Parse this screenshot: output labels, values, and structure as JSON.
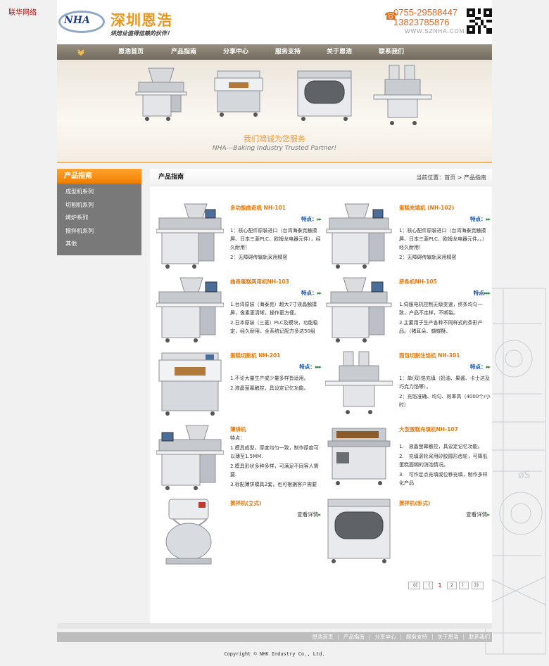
{
  "corner_link": "联华网络",
  "header": {
    "logo_mark": "NHA",
    "logo_name": "深圳恩浩",
    "slogan": "烘焙业值得信赖的伙伴！",
    "tel1": "0755-29588447",
    "tel2": "13823785876",
    "site": "WWW.SZNHA.COM"
  },
  "nav": {
    "items": [
      "恩浩首页",
      "产品指南",
      "分享中心",
      "服务支持",
      "关于恩浩",
      "联系我们"
    ]
  },
  "banner": {
    "slogan": "我们竭诚为您服务",
    "subtitle": "NHA---Baking Industry Trusted Partner!"
  },
  "sidebar": {
    "title": "产品指南",
    "items": [
      "成型机系列",
      "切割机系列",
      "烤炉系列",
      "搅拌机系列",
      "其他"
    ]
  },
  "main": {
    "title": "产品指南",
    "breadcrumb": {
      "prefix": "当前位置：",
      "home": "首页",
      "sep": ">",
      "current": "产品指南"
    }
  },
  "products": [
    {
      "name": "多功能曲奇机 NH-101",
      "tag": "特点：",
      "arrows": "▸▸",
      "desc": [
        "1：核心配件原装进口（台湾海泰克触摸屏、日本三菱PLC、欧姆龙电器元件），经久耐用！",
        "2：无障碍传输轨采用精密"
      ]
    },
    {
      "name": "蛋糕充填机 (NH-102)",
      "tag": "特点：",
      "arrows": "▸▸",
      "desc": [
        "1：核心配件原装进口（台湾海泰克触摸屏、日本三菱PLC、欧姆龙电器元件。。）经久耐用！",
        "2：无障碍传输轨采用精密"
      ]
    },
    {
      "name": "曲奇蛋糕两用机NH-103",
      "tag": "特点：",
      "arrows": "▸▸",
      "desc": [
        "1.台湾原装（海泰克）超大7寸液晶触摸屏，像素更清晰，操作更方便。",
        "2.日本原装（三菱）PLC及模块，功能稳定，经久耐用，全系统记配方多达50组"
      ]
    },
    {
      "name": "挤条机NH-105",
      "tag": "特点",
      "arrows": "▸▸▸",
      "desc": [
        "1.伺服电机控制无级变速，挤条均匀一致，产品不走样，不断裂。",
        "2.主要用于生产各种不同样式的条形产品。（猪耳朵、蝴蝶酥、"
      ]
    },
    {
      "name": "蛋糕切割机 NH-201",
      "tag": "特点：",
      "arrows": "▸▸▸",
      "desc": [
        "1.不论大量生产或少量多样皆适用。",
        "2.液晶萤幕触控，具设定记忆功能。"
      ]
    },
    {
      "name": "面包切割注馅机 NH-301",
      "tag": "特点：",
      "arrows": "▸▸",
      "desc": [
        "1：单(双)馅充填（奶油、果酱、卡士达及巧克力馅等）。",
        "2：充馅准确、均匀、效率高（4000个/小时）"
      ]
    },
    {
      "name": "薄饼机",
      "tag": "特点：",
      "arrows": "",
      "desc": [
        "1.模具成型，厚度均匀一致，制作厚度可以薄至1.5MM.",
        "2.模具形状多种多样，可满足不同客人需要.",
        "3.标配薄饼模具2套，也可根据客户需要订制各种模具"
      ]
    },
    {
      "name": "大型蛋糕充填机NH-107",
      "tag": "",
      "arrows": "",
      "desc": [
        "1.　液晶萤幕触控，具设定记忆功能。",
        "2.　充填滚轮采用矽胶圆形齿轮，可降低蛋糕面糊的消泡情况。",
        "3.　可作定点充填或位移充填，制作多样化产品"
      ]
    },
    {
      "name": "搅拌机(立式)",
      "more": "查看详情",
      "arrows": "▸"
    },
    {
      "name": "搅拌机(卧式)",
      "more": "查看详情",
      "arrows": "▸"
    }
  ],
  "pager": {
    "first": "《《",
    "prev": "〈",
    "page1": "1",
    "page2": "2",
    "next": "〉",
    "last": "》》"
  },
  "footer": {
    "nav": [
      "恩浩首页",
      "产品指南",
      "分享中心",
      "服务支持",
      "关于恩浩",
      "联系我们"
    ],
    "sep": "|",
    "copyright": "Copyright © NHK Industry Co., Ltd."
  },
  "colors": {
    "accent_orange": "#f08a10",
    "nav_gray": "#7d7568",
    "sidebar_gray": "#797979",
    "product_name": "#e2780a",
    "tag_blue": "#1750a6"
  }
}
